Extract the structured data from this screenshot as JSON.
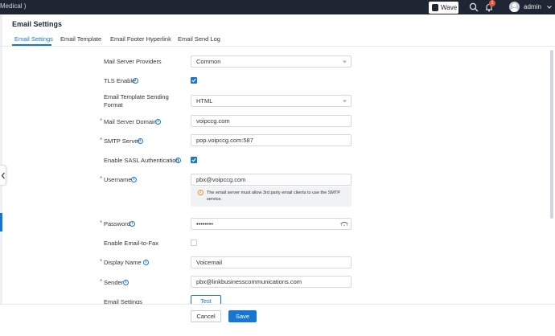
{
  "header": {
    "breadcrumb": "Medical )",
    "wave_label": "Wave",
    "notification_count": "1",
    "user": "admin"
  },
  "page": {
    "title": "Email Settings",
    "tabs": [
      {
        "label": "Email Settings",
        "active": true
      },
      {
        "label": "Email Template",
        "active": false
      },
      {
        "label": "Email Footer Hyperlink",
        "active": false
      },
      {
        "label": "Email Send Log",
        "active": false
      }
    ]
  },
  "form": {
    "mail_server_providers": {
      "label": "Mail Server Providers",
      "value": "Common"
    },
    "tls_enable": {
      "label": "TLS Enable",
      "checked": true
    },
    "template_format": {
      "label": "Email Template Sending Format",
      "value": "HTML"
    },
    "mail_server_domain": {
      "label": "Mail Server Domain",
      "value": "voipccg.com"
    },
    "smtp_server": {
      "label": "SMTP Server",
      "value": "pop.voipccg.com:587"
    },
    "sasl_auth": {
      "label": "Enable SASL Authentication",
      "checked": true
    },
    "username": {
      "label": "Username",
      "value": "pbx@voipccg.com"
    },
    "username_notice": "The email server must allow 3rd party email clients to use the SMTP service.",
    "password": {
      "label": "Password",
      "value": "••••••••"
    },
    "email_to_fax": {
      "label": "Enable Email-to-Fax",
      "checked": false
    },
    "display_name": {
      "label": "Display Name",
      "value": "Voicemail"
    },
    "sender": {
      "label": "Sender",
      "value": "pbx@linkbusinesscommunications.com"
    },
    "email_settings": {
      "label": "Email Settings",
      "button": "Test"
    }
  },
  "footer": {
    "cancel": "Cancel",
    "save": "Save"
  },
  "colors": {
    "accent": "#1677d2",
    "topbar": "#1f2533",
    "required": "#e5533d",
    "warning": "#f08c2d"
  },
  "icons": [
    "wave-logo-icon",
    "search-icon",
    "bell-icon",
    "avatar-icon",
    "chevron-down-icon",
    "info-icon",
    "check-icon",
    "eye-icon",
    "warning-icon",
    "chevron-left-icon"
  ]
}
